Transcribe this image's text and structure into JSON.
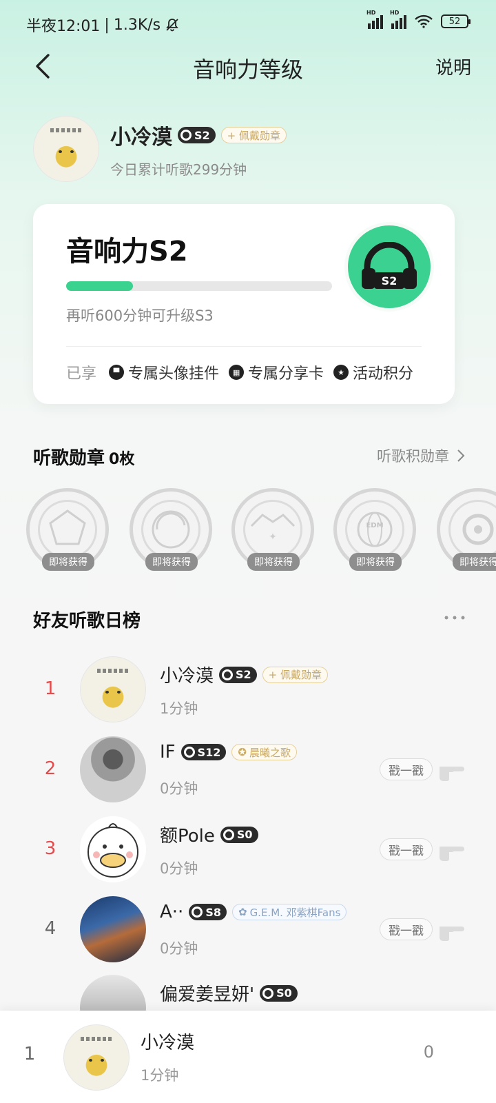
{
  "status": {
    "time": "半夜12:01",
    "speed": "1.3K/s",
    "battery": "52"
  },
  "nav": {
    "title": "音响力等级",
    "help": "说明"
  },
  "user": {
    "name": "小冷漠",
    "level_badge": "S2",
    "wear_badge": "+ 佩戴勋章",
    "today": "今日累计听歌299分钟"
  },
  "card": {
    "title": "音响力S2",
    "progress_fraction": 0.25,
    "hint": "再听600分钟可升级S3",
    "perks_label": "已享",
    "perks": [
      "专属头像挂件",
      "专属分享卡",
      "活动积分"
    ],
    "level_icon_label": "S2"
  },
  "medals": {
    "title": "听歌勋章",
    "count": "0枚",
    "link": "听歌积勋章",
    "items": [
      "即将获得",
      "即将获得",
      "即将获得",
      "即将获得",
      "即将获得"
    ]
  },
  "ranking": {
    "title": "好友听歌日榜",
    "poke_label": "戳一戳",
    "rows": [
      {
        "rank": "1",
        "name": "小冷漠",
        "level": "S2",
        "badge": "+ 佩戴勋章",
        "time": "1分钟"
      },
      {
        "rank": "2",
        "name": "IF",
        "level": "S12",
        "badge": "晨曦之歌",
        "time": "0分钟"
      },
      {
        "rank": "3",
        "name": "额Pole",
        "level": "S0",
        "badge": "",
        "time": "0分钟"
      },
      {
        "rank": "4",
        "name": "A··",
        "level": "S8",
        "badge": "G.E.M. 邓紫棋Fans",
        "time": "0分钟"
      },
      {
        "rank": "",
        "name": "偏爱姜昱妍'",
        "level": "S0",
        "badge": "",
        "time": ""
      }
    ]
  },
  "bottom": {
    "rank": "1",
    "name": "小冷漠",
    "time": "1分钟",
    "score": "0"
  },
  "colors": {
    "accent": "#3ad28f",
    "rank_top": "#e84b4b",
    "rank_normal": "#666666"
  }
}
